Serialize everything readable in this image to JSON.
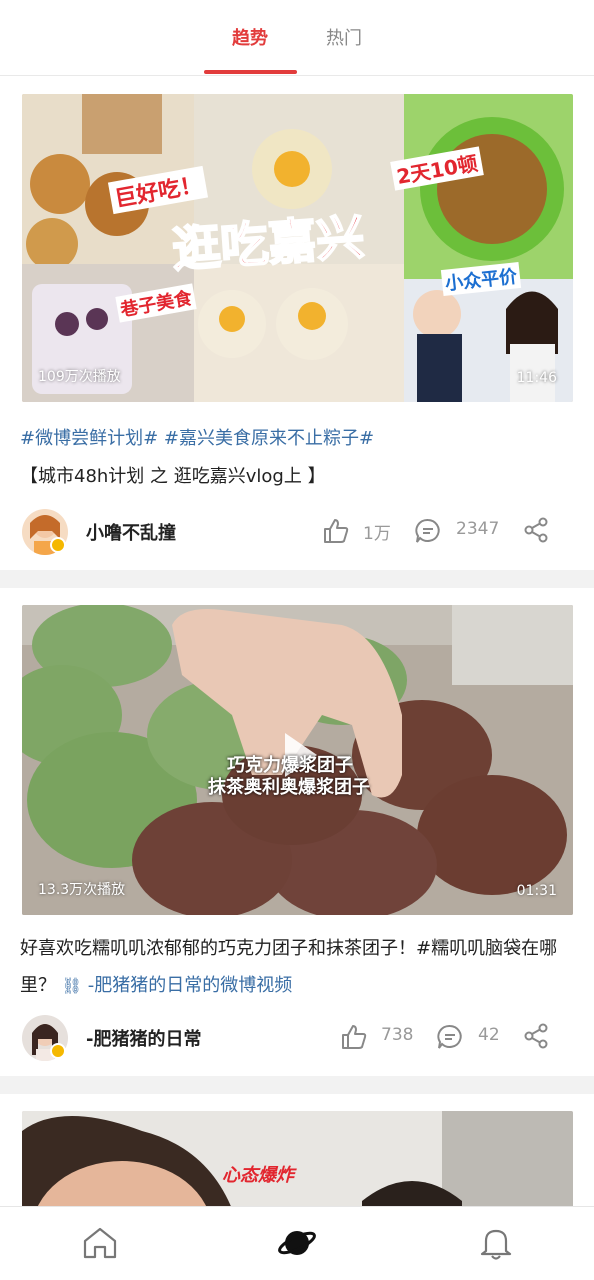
{
  "tabs": {
    "trend": "趋势",
    "hot": "热门"
  },
  "posts": [
    {
      "thumbnail_overlays": {
        "title": "逛吃嘉兴",
        "tag_great": "巨好吃！",
        "tag_days": "2天10顿",
        "tag_alley": "巷子美食",
        "tag_cheap": "小众平价"
      },
      "plays": "109万次播放",
      "duration": "11:46",
      "tags": "#微博尝鲜计划# #嘉兴美食原来不止粽子#",
      "title": "【城市48h计划 之 逛吃嘉兴vlog上 】",
      "author": "小噜不乱撞",
      "likes": "1万",
      "comments": "2347"
    },
    {
      "overlay_line1": "巧克力爆浆团子",
      "overlay_line2": "抹茶奥利奥爆浆团子",
      "plays": "13.3万次播放",
      "duration": "01:31",
      "text": "好喜欢吃糯叽叽浓郁郁的巧克力团子和抹茶团子！#糯叽叽脑袋在哪里？",
      "link": "-肥猪猪的日常的微博视频",
      "author": "-肥猪猪的日常",
      "likes": "738",
      "comments": "42"
    },
    {
      "overlay_text": "心态爆炸"
    }
  ],
  "icons": {
    "like": "thumbs-up-icon",
    "comment": "comment-icon",
    "share": "share-icon",
    "home": "home-icon",
    "discover": "planet-icon",
    "notify": "bell-icon"
  },
  "colors": {
    "accent": "#e23c3c",
    "link": "#3a6ea5"
  }
}
